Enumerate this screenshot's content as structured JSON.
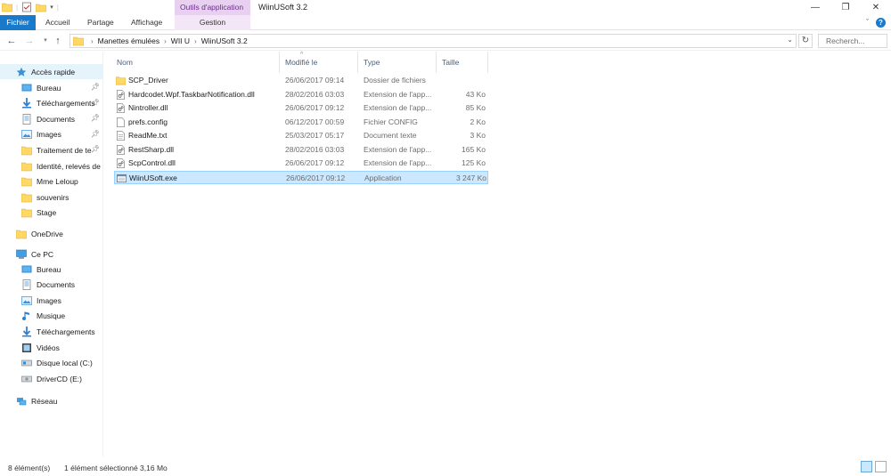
{
  "window": {
    "title": "WiinUSoft 3.2",
    "context_tab_group": "Outils d'application",
    "controls": [
      "—",
      "❐",
      "✕"
    ]
  },
  "ribbon": {
    "tabs": [
      {
        "label": "Fichier"
      },
      {
        "label": "Accueil"
      },
      {
        "label": "Partage"
      },
      {
        "label": "Affichage"
      },
      {
        "label": "Gestion"
      }
    ],
    "collapse_icon": "ˇ",
    "help_icon": "?"
  },
  "address": {
    "breadcrumbs": [
      "Manettes émulées",
      "WII U",
      "WiinUSoft 3.2"
    ],
    "search_placeholder": "Recherch..."
  },
  "sidebar": {
    "quick_access": {
      "label": "Accès rapide"
    },
    "quick_items": [
      {
        "label": "Bureau",
        "icon": "desktop-icon",
        "pinned": true
      },
      {
        "label": "Téléchargements",
        "icon": "download-icon",
        "pinned": true
      },
      {
        "label": "Documents",
        "icon": "documents-icon",
        "pinned": true
      },
      {
        "label": "Images",
        "icon": "images-icon",
        "pinned": true
      },
      {
        "label": "Traitement de te",
        "icon": "folder-icon",
        "pinned": true
      },
      {
        "label": "Identité, relevés de",
        "icon": "folder-icon",
        "pinned": false
      },
      {
        "label": "Mme Leloup",
        "icon": "folder-icon",
        "pinned": false
      },
      {
        "label": "souvenirs",
        "icon": "folder-icon",
        "pinned": false
      },
      {
        "label": "Stage",
        "icon": "folder-icon",
        "pinned": false
      }
    ],
    "onedrive": {
      "label": "OneDrive"
    },
    "this_pc": {
      "label": "Ce PC"
    },
    "pc_items": [
      {
        "label": "Bureau",
        "icon": "desktop-icon"
      },
      {
        "label": "Documents",
        "icon": "documents-icon"
      },
      {
        "label": "Images",
        "icon": "images-icon"
      },
      {
        "label": "Musique",
        "icon": "music-icon"
      },
      {
        "label": "Téléchargements",
        "icon": "download-icon"
      },
      {
        "label": "Vidéos",
        "icon": "video-icon"
      },
      {
        "label": "Disque local (C:)",
        "icon": "drive-icon"
      },
      {
        "label": "DriverCD (E:)",
        "icon": "cd-drive-icon"
      }
    ],
    "network": {
      "label": "Réseau"
    }
  },
  "columns": {
    "name": "Nom",
    "modified": "Modifié le",
    "type": "Type",
    "size": "Taille"
  },
  "files": [
    {
      "name": "SCP_Driver",
      "modified": "26/06/2017 09:14",
      "type": "Dossier de fichiers",
      "size": "",
      "icon": "folder-icon",
      "selected": false
    },
    {
      "name": "Hardcodet.Wpf.TaskbarNotification.dll",
      "modified": "28/02/2016 03:03",
      "type": "Extension de l'app...",
      "size": "43 Ko",
      "icon": "dll-icon",
      "selected": false
    },
    {
      "name": "Nintroller.dll",
      "modified": "26/06/2017 09:12",
      "type": "Extension de l'app...",
      "size": "85 Ko",
      "icon": "dll-icon",
      "selected": false
    },
    {
      "name": "prefs.config",
      "modified": "06/12/2017 00:59",
      "type": "Fichier CONFIG",
      "size": "2 Ko",
      "icon": "file-icon",
      "selected": false
    },
    {
      "name": "ReadMe.txt",
      "modified": "25/03/2017 05:17",
      "type": "Document texte",
      "size": "3 Ko",
      "icon": "text-file-icon",
      "selected": false
    },
    {
      "name": "RestSharp.dll",
      "modified": "28/02/2016 03:03",
      "type": "Extension de l'app...",
      "size": "165 Ko",
      "icon": "dll-icon",
      "selected": false
    },
    {
      "name": "ScpControl.dll",
      "modified": "26/06/2017 09:12",
      "type": "Extension de l'app...",
      "size": "125 Ko",
      "icon": "dll-icon",
      "selected": false
    },
    {
      "name": "WiinUSoft.exe",
      "modified": "26/06/2017 09:12",
      "type": "Application",
      "size": "3 247 Ko",
      "icon": "application-icon",
      "selected": true
    }
  ],
  "status": {
    "count": "8 élément(s)",
    "selection": "1 élément sélectionné  3,16 Mo"
  },
  "colors": {
    "accent": "#1979ca",
    "selection": "#cce8ff",
    "context_tab": "#e8d1f0",
    "folder": "#ffd866"
  }
}
